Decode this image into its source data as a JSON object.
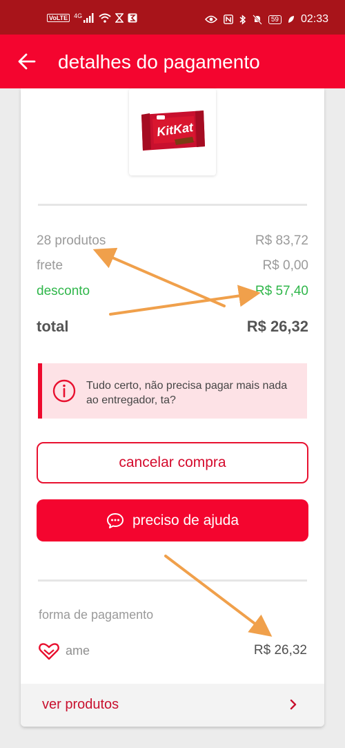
{
  "status_bar": {
    "volte": "VoLTE",
    "network": "4G",
    "battery": "59",
    "time": "02:33"
  },
  "app_bar": {
    "title": "detalhes do pagamento",
    "back_icon": "arrow-left-icon"
  },
  "product": {
    "image_icon": "kitkat-product-image"
  },
  "summary": {
    "products_label": "28 produtos",
    "products_value": "R$ 83,72",
    "shipping_label": "frete",
    "shipping_value": "R$ 0,00",
    "discount_label": "desconto",
    "discount_value": "- R$ 57,40",
    "total_label": "total",
    "total_value": "R$ 26,32"
  },
  "notice": {
    "icon": "info-icon",
    "text": "Tudo certo, não precisa pagar mais nada ao entregador, ta?"
  },
  "actions": {
    "cancel_label": "cancelar compra",
    "help_label": "preciso de ajuda",
    "help_icon": "chat-bubble-icon"
  },
  "payment": {
    "section_label": "forma de pagamento",
    "method_icon": "ame-heart-icon",
    "method_label": "ame",
    "method_value": "R$ 26,32"
  },
  "footer": {
    "ver_label": "ver produtos",
    "chevron_icon": "chevron-right-icon"
  },
  "colors": {
    "brand_red": "#f4052f",
    "status_bar": "#a8141a",
    "discount_green": "#2fb64a",
    "annotation_orange": "#f0a04b"
  }
}
